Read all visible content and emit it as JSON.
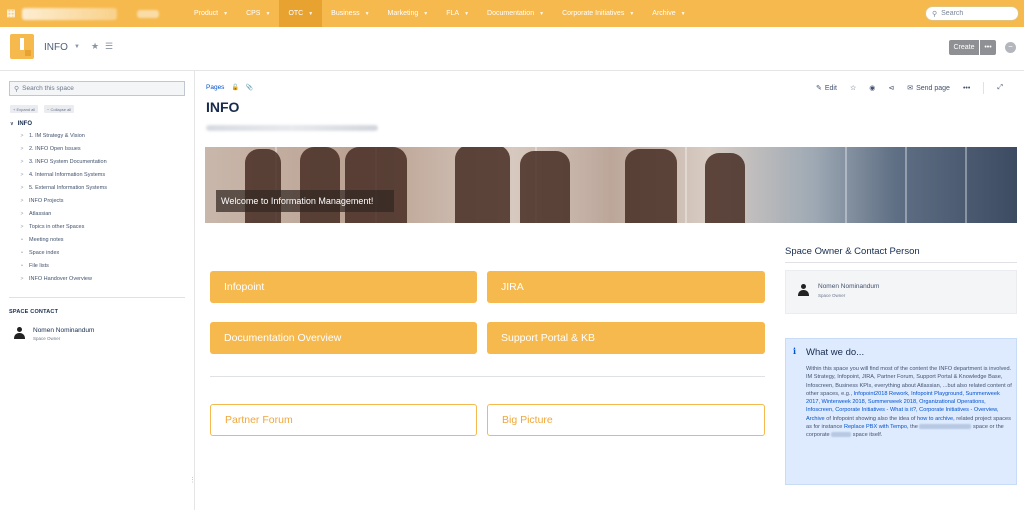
{
  "topbar": {
    "menu": [
      {
        "label": "Product",
        "active": false
      },
      {
        "label": "CPS",
        "active": false
      },
      {
        "label": "OTC",
        "active": true
      },
      {
        "label": "Business",
        "active": false
      },
      {
        "label": "Marketing",
        "active": false
      },
      {
        "label": "FLA",
        "active": false
      },
      {
        "label": "Documentation",
        "active": false
      },
      {
        "label": "Corporate Initiatives",
        "active": false
      },
      {
        "label": "Archive",
        "active": false
      }
    ],
    "search_placeholder": "Search",
    "accent_color": "#f6b94d"
  },
  "space_header": {
    "space_name": "INFO",
    "create_label": "Create",
    "more_label": "•••"
  },
  "sidebar": {
    "search_placeholder": "Search this space",
    "expand_all": "Expand all",
    "collapse_all": "Collapse all",
    "root": "INFO",
    "items": [
      {
        "label": "1. IM Strategy & Vision",
        "marker": ">"
      },
      {
        "label": "2. INFO Open Issues",
        "marker": ">"
      },
      {
        "label": "3. INFO System Documentation",
        "marker": ">"
      },
      {
        "label": "4. Internal Information Systems",
        "marker": ">"
      },
      {
        "label": "5. External Information Systems",
        "marker": ">"
      },
      {
        "label": "INFO Projects",
        "marker": ">"
      },
      {
        "label": "Atlassian",
        "marker": ">"
      },
      {
        "label": "Topics in other Spaces",
        "marker": ">"
      },
      {
        "label": "Meeting notes",
        "marker": "•"
      },
      {
        "label": "Space index",
        "marker": "•"
      },
      {
        "label": "File lists",
        "marker": "•"
      },
      {
        "label": "INFO Handover Overview",
        "marker": ">"
      }
    ],
    "space_contact_title": "SPACE CONTACT",
    "contact_name": "Nomen Nominandum",
    "contact_role": "Space Owner"
  },
  "page": {
    "breadcrumb": "Pages",
    "title": "INFO",
    "actions": {
      "edit": "Edit",
      "send": "Send page",
      "more": "•••"
    },
    "banner_caption": "Welcome to Information Management!",
    "tiles": [
      {
        "label": "Infopoint",
        "style": "filled"
      },
      {
        "label": "JIRA",
        "style": "filled"
      },
      {
        "label": "Documentation Overview",
        "style": "filled"
      },
      {
        "label": "Support Portal & KB",
        "style": "filled"
      },
      {
        "label": "Partner Forum",
        "style": "outline"
      },
      {
        "label": "Big Picture",
        "style": "outline"
      }
    ]
  },
  "right_panel": {
    "owner_title": "Space Owner & Contact Person",
    "owner_name": "Nomen Nominandum",
    "owner_role": "Space Owner",
    "info_title": "What we do...",
    "info_text_1": "Within this space you will find most of the content the INFO department is involved. IM Strategy, Infopoint, JIRA, Partner Forum, Support Portal & Knowledge Base, Infoscreen, Business KPIs, everything about Atlassian, ...but also related content of other spaces, e.g.,",
    "info_links_1": "Infopoint2018 Rework, Infopoint Playground, Summerweek 2017, Winterweek 2018, Summerweek 2018, Organizational Operations, Infoscreen, Corporate Initiatives - What is it?, Corporate Initiatives - Overview, Archive",
    "info_text_2": "of Infopoint showing also the idea of",
    "info_link_2": "how to archive,",
    "info_text_3": "related project spaces as for instance",
    "info_link_3": "Replace PBX with Tempo,",
    "info_text_4": "the",
    "info_text_5": "space or the corporate",
    "info_text_6": "space itself."
  }
}
